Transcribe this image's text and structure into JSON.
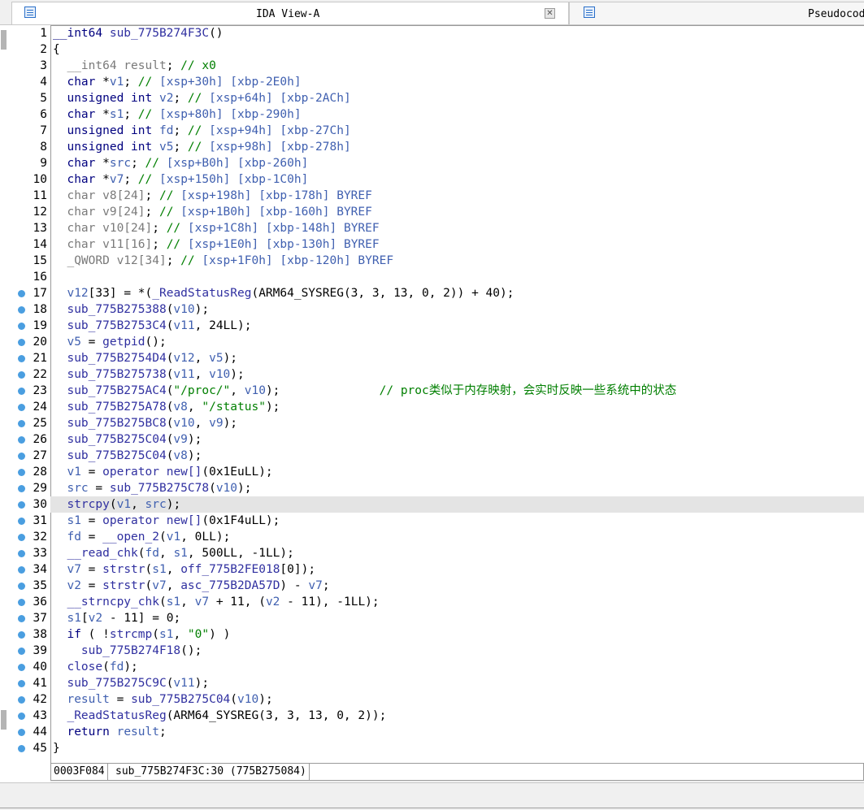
{
  "tabs": [
    {
      "title": "IDA View-A",
      "icon": "document-icon",
      "closable": true
    },
    {
      "title": "Pseudocode",
      "icon": "document-icon",
      "closable": false
    }
  ],
  "code_lines": [
    {
      "n": "1",
      "bp": false,
      "tokens": [
        [
          "t-k",
          "__int64"
        ],
        [
          "t-n",
          " "
        ],
        [
          "t-c",
          "sub_775B274F3C"
        ],
        [
          "t-n",
          "()"
        ]
      ]
    },
    {
      "n": "2",
      "bp": false,
      "tokens": [
        [
          "t-n",
          "{"
        ]
      ]
    },
    {
      "n": "3",
      "bp": false,
      "tokens": [
        [
          "t-n",
          "  "
        ],
        [
          "t-g",
          "__int64 result"
        ],
        [
          "t-n",
          "; "
        ],
        [
          "t-cm",
          "// x0"
        ]
      ]
    },
    {
      "n": "4",
      "bp": false,
      "tokens": [
        [
          "t-n",
          "  "
        ],
        [
          "t-k",
          "char"
        ],
        [
          "t-n",
          " *"
        ],
        [
          "t-v",
          "v1"
        ],
        [
          "t-n",
          "; "
        ],
        [
          "t-cm",
          "// "
        ],
        [
          "t-v",
          "[xsp+30h] [xbp-2E0h]"
        ]
      ]
    },
    {
      "n": "5",
      "bp": false,
      "tokens": [
        [
          "t-n",
          "  "
        ],
        [
          "t-k",
          "unsigned int"
        ],
        [
          "t-n",
          " "
        ],
        [
          "t-v",
          "v2"
        ],
        [
          "t-n",
          "; "
        ],
        [
          "t-cm",
          "// "
        ],
        [
          "t-v",
          "[xsp+64h] [xbp-2ACh]"
        ]
      ]
    },
    {
      "n": "6",
      "bp": false,
      "tokens": [
        [
          "t-n",
          "  "
        ],
        [
          "t-k",
          "char"
        ],
        [
          "t-n",
          " *"
        ],
        [
          "t-v",
          "s1"
        ],
        [
          "t-n",
          "; "
        ],
        [
          "t-cm",
          "// "
        ],
        [
          "t-v",
          "[xsp+80h] [xbp-290h]"
        ]
      ]
    },
    {
      "n": "7",
      "bp": false,
      "tokens": [
        [
          "t-n",
          "  "
        ],
        [
          "t-k",
          "unsigned int"
        ],
        [
          "t-n",
          " "
        ],
        [
          "t-v",
          "fd"
        ],
        [
          "t-n",
          "; "
        ],
        [
          "t-cm",
          "// "
        ],
        [
          "t-v",
          "[xsp+94h] [xbp-27Ch]"
        ]
      ]
    },
    {
      "n": "8",
      "bp": false,
      "tokens": [
        [
          "t-n",
          "  "
        ],
        [
          "t-k",
          "unsigned int"
        ],
        [
          "t-n",
          " "
        ],
        [
          "t-v",
          "v5"
        ],
        [
          "t-n",
          "; "
        ],
        [
          "t-cm",
          "// "
        ],
        [
          "t-v",
          "[xsp+98h] [xbp-278h]"
        ]
      ]
    },
    {
      "n": "9",
      "bp": false,
      "tokens": [
        [
          "t-n",
          "  "
        ],
        [
          "t-k",
          "char"
        ],
        [
          "t-n",
          " *"
        ],
        [
          "t-v",
          "src"
        ],
        [
          "t-n",
          "; "
        ],
        [
          "t-cm",
          "// "
        ],
        [
          "t-v",
          "[xsp+B0h] [xbp-260h]"
        ]
      ]
    },
    {
      "n": "10",
      "bp": false,
      "tokens": [
        [
          "t-n",
          "  "
        ],
        [
          "t-k",
          "char"
        ],
        [
          "t-n",
          " *"
        ],
        [
          "t-v",
          "v7"
        ],
        [
          "t-n",
          "; "
        ],
        [
          "t-cm",
          "// "
        ],
        [
          "t-v",
          "[xsp+150h] [xbp-1C0h]"
        ]
      ]
    },
    {
      "n": "11",
      "bp": false,
      "tokens": [
        [
          "t-n",
          "  "
        ],
        [
          "t-g",
          "char v8[24]"
        ],
        [
          "t-n",
          "; "
        ],
        [
          "t-cm",
          "// "
        ],
        [
          "t-v",
          "[xsp+198h] [xbp-178h] BYREF"
        ]
      ]
    },
    {
      "n": "12",
      "bp": false,
      "tokens": [
        [
          "t-n",
          "  "
        ],
        [
          "t-g",
          "char v9[24]"
        ],
        [
          "t-n",
          "; "
        ],
        [
          "t-cm",
          "// "
        ],
        [
          "t-v",
          "[xsp+1B0h] [xbp-160h] BYREF"
        ]
      ]
    },
    {
      "n": "13",
      "bp": false,
      "tokens": [
        [
          "t-n",
          "  "
        ],
        [
          "t-g",
          "char v10[24]"
        ],
        [
          "t-n",
          "; "
        ],
        [
          "t-cm",
          "// "
        ],
        [
          "t-v",
          "[xsp+1C8h] [xbp-148h] BYREF"
        ]
      ]
    },
    {
      "n": "14",
      "bp": false,
      "tokens": [
        [
          "t-n",
          "  "
        ],
        [
          "t-g",
          "char v11[16]"
        ],
        [
          "t-n",
          "; "
        ],
        [
          "t-cm",
          "// "
        ],
        [
          "t-v",
          "[xsp+1E0h] [xbp-130h] BYREF"
        ]
      ]
    },
    {
      "n": "15",
      "bp": false,
      "tokens": [
        [
          "t-n",
          "  "
        ],
        [
          "t-g",
          "_QWORD v12[34]"
        ],
        [
          "t-n",
          "; "
        ],
        [
          "t-cm",
          "// "
        ],
        [
          "t-v",
          "[xsp+1F0h] [xbp-120h] BYREF"
        ]
      ]
    },
    {
      "n": "16",
      "bp": false,
      "tokens": []
    },
    {
      "n": "17",
      "bp": true,
      "tokens": [
        [
          "t-n",
          "  "
        ],
        [
          "t-v",
          "v12"
        ],
        [
          "t-n",
          "[33] = *("
        ],
        [
          "t-c",
          "_ReadStatusReg"
        ],
        [
          "t-n",
          "(ARM64_SYSREG(3, 3, 13, 0, 2)) + 40);"
        ]
      ]
    },
    {
      "n": "18",
      "bp": true,
      "tokens": [
        [
          "t-n",
          "  "
        ],
        [
          "t-c",
          "sub_775B275388"
        ],
        [
          "t-n",
          "("
        ],
        [
          "t-v",
          "v10"
        ],
        [
          "t-n",
          ");"
        ]
      ]
    },
    {
      "n": "19",
      "bp": true,
      "tokens": [
        [
          "t-n",
          "  "
        ],
        [
          "t-c",
          "sub_775B2753C4"
        ],
        [
          "t-n",
          "("
        ],
        [
          "t-v",
          "v11"
        ],
        [
          "t-n",
          ", 24LL);"
        ]
      ]
    },
    {
      "n": "20",
      "bp": true,
      "tokens": [
        [
          "t-n",
          "  "
        ],
        [
          "t-v",
          "v5"
        ],
        [
          "t-n",
          " = "
        ],
        [
          "t-c",
          "getpid"
        ],
        [
          "t-n",
          "();"
        ]
      ]
    },
    {
      "n": "21",
      "bp": true,
      "tokens": [
        [
          "t-n",
          "  "
        ],
        [
          "t-c",
          "sub_775B2754D4"
        ],
        [
          "t-n",
          "("
        ],
        [
          "t-v",
          "v12"
        ],
        [
          "t-n",
          ", "
        ],
        [
          "t-v",
          "v5"
        ],
        [
          "t-n",
          ");"
        ]
      ]
    },
    {
      "n": "22",
      "bp": true,
      "tokens": [
        [
          "t-n",
          "  "
        ],
        [
          "t-c",
          "sub_775B275738"
        ],
        [
          "t-n",
          "("
        ],
        [
          "t-v",
          "v11"
        ],
        [
          "t-n",
          ", "
        ],
        [
          "t-v",
          "v10"
        ],
        [
          "t-n",
          ");"
        ]
      ]
    },
    {
      "n": "23",
      "bp": true,
      "tokens": [
        [
          "t-n",
          "  "
        ],
        [
          "t-c",
          "sub_775B275AC4"
        ],
        [
          "t-n",
          "("
        ],
        [
          "t-s",
          "\"/proc/\""
        ],
        [
          "t-n",
          ", "
        ],
        [
          "t-v",
          "v10"
        ],
        [
          "t-n",
          ");              "
        ],
        [
          "t-cm",
          "// proc类似于内存映射，会实时反映一些系统中的状态"
        ]
      ]
    },
    {
      "n": "24",
      "bp": true,
      "tokens": [
        [
          "t-n",
          "  "
        ],
        [
          "t-c",
          "sub_775B275A78"
        ],
        [
          "t-n",
          "("
        ],
        [
          "t-v",
          "v8"
        ],
        [
          "t-n",
          ", "
        ],
        [
          "t-s",
          "\"/status\""
        ],
        [
          "t-n",
          ");"
        ]
      ]
    },
    {
      "n": "25",
      "bp": true,
      "tokens": [
        [
          "t-n",
          "  "
        ],
        [
          "t-c",
          "sub_775B275BC8"
        ],
        [
          "t-n",
          "("
        ],
        [
          "t-v",
          "v10"
        ],
        [
          "t-n",
          ", "
        ],
        [
          "t-v",
          "v9"
        ],
        [
          "t-n",
          ");"
        ]
      ]
    },
    {
      "n": "26",
      "bp": true,
      "tokens": [
        [
          "t-n",
          "  "
        ],
        [
          "t-c",
          "sub_775B275C04"
        ],
        [
          "t-n",
          "("
        ],
        [
          "t-v",
          "v9"
        ],
        [
          "t-n",
          ");"
        ]
      ]
    },
    {
      "n": "27",
      "bp": true,
      "tokens": [
        [
          "t-n",
          "  "
        ],
        [
          "t-c",
          "sub_775B275C04"
        ],
        [
          "t-n",
          "("
        ],
        [
          "t-v",
          "v8"
        ],
        [
          "t-n",
          ");"
        ]
      ]
    },
    {
      "n": "28",
      "bp": true,
      "tokens": [
        [
          "t-n",
          "  "
        ],
        [
          "t-v",
          "v1"
        ],
        [
          "t-n",
          " = "
        ],
        [
          "t-c",
          "operator new[]"
        ],
        [
          "t-n",
          "(0x1EuLL);"
        ]
      ]
    },
    {
      "n": "29",
      "bp": true,
      "tokens": [
        [
          "t-n",
          "  "
        ],
        [
          "t-v",
          "src"
        ],
        [
          "t-n",
          " = "
        ],
        [
          "t-c",
          "sub_775B275C78"
        ],
        [
          "t-n",
          "("
        ],
        [
          "t-v",
          "v10"
        ],
        [
          "t-n",
          ");"
        ]
      ]
    },
    {
      "n": "30",
      "bp": true,
      "hl": true,
      "tokens": [
        [
          "t-n",
          "  "
        ],
        [
          "t-c",
          "strcpy"
        ],
        [
          "t-n",
          "("
        ],
        [
          "t-v",
          "v1"
        ],
        [
          "t-n",
          ", "
        ],
        [
          "t-v",
          "src"
        ],
        [
          "t-n",
          ");"
        ]
      ]
    },
    {
      "n": "31",
      "bp": true,
      "tokens": [
        [
          "t-n",
          "  "
        ],
        [
          "t-v",
          "s1"
        ],
        [
          "t-n",
          " = "
        ],
        [
          "t-c",
          "operator new[]"
        ],
        [
          "t-n",
          "(0x1F4uLL);"
        ]
      ]
    },
    {
      "n": "32",
      "bp": true,
      "tokens": [
        [
          "t-n",
          "  "
        ],
        [
          "t-v",
          "fd"
        ],
        [
          "t-n",
          " = "
        ],
        [
          "t-c",
          "__open_2"
        ],
        [
          "t-n",
          "("
        ],
        [
          "t-v",
          "v1"
        ],
        [
          "t-n",
          ", 0LL);"
        ]
      ]
    },
    {
      "n": "33",
      "bp": true,
      "tokens": [
        [
          "t-n",
          "  "
        ],
        [
          "t-c",
          "__read_chk"
        ],
        [
          "t-n",
          "("
        ],
        [
          "t-v",
          "fd"
        ],
        [
          "t-n",
          ", "
        ],
        [
          "t-v",
          "s1"
        ],
        [
          "t-n",
          ", 500LL, -1LL);"
        ]
      ]
    },
    {
      "n": "34",
      "bp": true,
      "tokens": [
        [
          "t-n",
          "  "
        ],
        [
          "t-v",
          "v7"
        ],
        [
          "t-n",
          " = "
        ],
        [
          "t-c",
          "strstr"
        ],
        [
          "t-n",
          "("
        ],
        [
          "t-v",
          "s1"
        ],
        [
          "t-n",
          ", "
        ],
        [
          "t-c",
          "off_775B2FE018"
        ],
        [
          "t-n",
          "[0]);"
        ]
      ]
    },
    {
      "n": "35",
      "bp": true,
      "tokens": [
        [
          "t-n",
          "  "
        ],
        [
          "t-v",
          "v2"
        ],
        [
          "t-n",
          " = "
        ],
        [
          "t-c",
          "strstr"
        ],
        [
          "t-n",
          "("
        ],
        [
          "t-v",
          "v7"
        ],
        [
          "t-n",
          ", "
        ],
        [
          "t-c",
          "asc_775B2DA57D"
        ],
        [
          "t-n",
          ") - "
        ],
        [
          "t-v",
          "v7"
        ],
        [
          "t-n",
          ";"
        ]
      ]
    },
    {
      "n": "36",
      "bp": true,
      "tokens": [
        [
          "t-n",
          "  "
        ],
        [
          "t-c",
          "__strncpy_chk"
        ],
        [
          "t-n",
          "("
        ],
        [
          "t-v",
          "s1"
        ],
        [
          "t-n",
          ", "
        ],
        [
          "t-v",
          "v7"
        ],
        [
          "t-n",
          " + 11, ("
        ],
        [
          "t-v",
          "v2"
        ],
        [
          "t-n",
          " - 11), -1LL);"
        ]
      ]
    },
    {
      "n": "37",
      "bp": true,
      "tokens": [
        [
          "t-n",
          "  "
        ],
        [
          "t-v",
          "s1"
        ],
        [
          "t-n",
          "["
        ],
        [
          "t-v",
          "v2"
        ],
        [
          "t-n",
          " - 11] = 0;"
        ]
      ]
    },
    {
      "n": "38",
      "bp": true,
      "tokens": [
        [
          "t-n",
          "  "
        ],
        [
          "t-k",
          "if"
        ],
        [
          "t-n",
          " ( !"
        ],
        [
          "t-c",
          "strcmp"
        ],
        [
          "t-n",
          "("
        ],
        [
          "t-v",
          "s1"
        ],
        [
          "t-n",
          ", "
        ],
        [
          "t-s",
          "\"0\""
        ],
        [
          "t-n",
          ") )"
        ]
      ]
    },
    {
      "n": "39",
      "bp": true,
      "tokens": [
        [
          "t-n",
          "    "
        ],
        [
          "t-c",
          "sub_775B274F18"
        ],
        [
          "t-n",
          "();"
        ]
      ]
    },
    {
      "n": "40",
      "bp": true,
      "tokens": [
        [
          "t-n",
          "  "
        ],
        [
          "t-c",
          "close"
        ],
        [
          "t-n",
          "("
        ],
        [
          "t-v",
          "fd"
        ],
        [
          "t-n",
          ");"
        ]
      ]
    },
    {
      "n": "41",
      "bp": true,
      "tokens": [
        [
          "t-n",
          "  "
        ],
        [
          "t-c",
          "sub_775B275C9C"
        ],
        [
          "t-n",
          "("
        ],
        [
          "t-v",
          "v11"
        ],
        [
          "t-n",
          ");"
        ]
      ]
    },
    {
      "n": "42",
      "bp": true,
      "tokens": [
        [
          "t-n",
          "  "
        ],
        [
          "t-v",
          "result"
        ],
        [
          "t-n",
          " = "
        ],
        [
          "t-c",
          "sub_775B275C04"
        ],
        [
          "t-n",
          "("
        ],
        [
          "t-v",
          "v10"
        ],
        [
          "t-n",
          ");"
        ]
      ]
    },
    {
      "n": "43",
      "bp": true,
      "tokens": [
        [
          "t-n",
          "  "
        ],
        [
          "t-c",
          "_ReadStatusReg"
        ],
        [
          "t-n",
          "(ARM64_SYSREG(3, 3, 13, 0, 2));"
        ]
      ]
    },
    {
      "n": "44",
      "bp": true,
      "tokens": [
        [
          "t-n",
          "  "
        ],
        [
          "t-k",
          "return"
        ],
        [
          "t-n",
          " "
        ],
        [
          "t-v",
          "result"
        ],
        [
          "t-n",
          ";"
        ]
      ]
    },
    {
      "n": "45",
      "bp": true,
      "tokens": [
        [
          "t-n",
          "}"
        ]
      ]
    }
  ],
  "status": {
    "address": "0003F084",
    "location": "sub_775B274F3C:30 (775B275084)"
  }
}
